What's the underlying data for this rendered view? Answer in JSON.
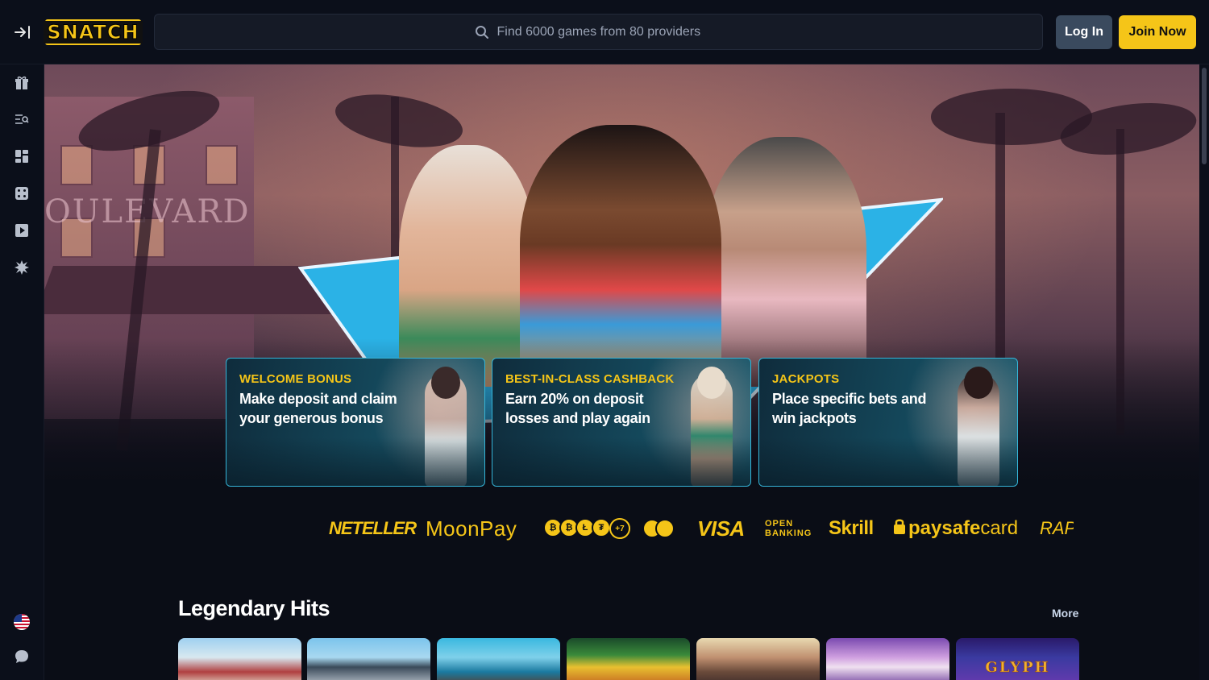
{
  "header": {
    "logo_text": "SNATCH",
    "search_placeholder": "Find 6000 games from 80 providers",
    "login_label": "Log In",
    "join_label": "Join Now"
  },
  "sidebar": {
    "items": [
      {
        "icon": "gift-icon"
      },
      {
        "icon": "search-list-icon"
      },
      {
        "icon": "grid-icon"
      },
      {
        "icon": "dice-icon"
      },
      {
        "icon": "play-icon"
      },
      {
        "icon": "burst-icon"
      }
    ],
    "bottom": [
      {
        "icon": "us-flag-icon"
      },
      {
        "icon": "chat-icon"
      }
    ]
  },
  "hero": {
    "sign_text": "OULEVARD"
  },
  "promos": [
    {
      "eyebrow": "WELCOME BONUS",
      "text": "Make deposit and claim your generous bonus"
    },
    {
      "eyebrow": "BEST-IN-CLASS CASHBACK",
      "text": "Earn 20% on deposit losses and play again"
    },
    {
      "eyebrow": "JACKPOTS",
      "text": "Place specific bets and win jackpots"
    }
  ],
  "payments": {
    "neteller": "NETELLER",
    "moonpay": "MoonPay",
    "crypto_more": "+7",
    "visa": "VISA",
    "open_banking_1": "OPEN",
    "open_banking_2": "BANKING",
    "skrill": "Skrill",
    "paysafe_bold": "paysafe",
    "paysafe_light": "card",
    "rapid": "RAPI"
  },
  "section": {
    "title": "Legendary Hits",
    "more_label": "More"
  },
  "games": [
    {
      "name": "game-1"
    },
    {
      "name": "game-2"
    },
    {
      "name": "game-3"
    },
    {
      "name": "game-4"
    },
    {
      "name": "game-5"
    },
    {
      "name": "game-6"
    },
    {
      "name": "game-7",
      "label": "GLYPH"
    }
  ],
  "colors": {
    "accent": "#f5c518",
    "background": "#0a0d16",
    "promo_border": "#35b5d8",
    "login_bg": "#3a4a5e"
  }
}
